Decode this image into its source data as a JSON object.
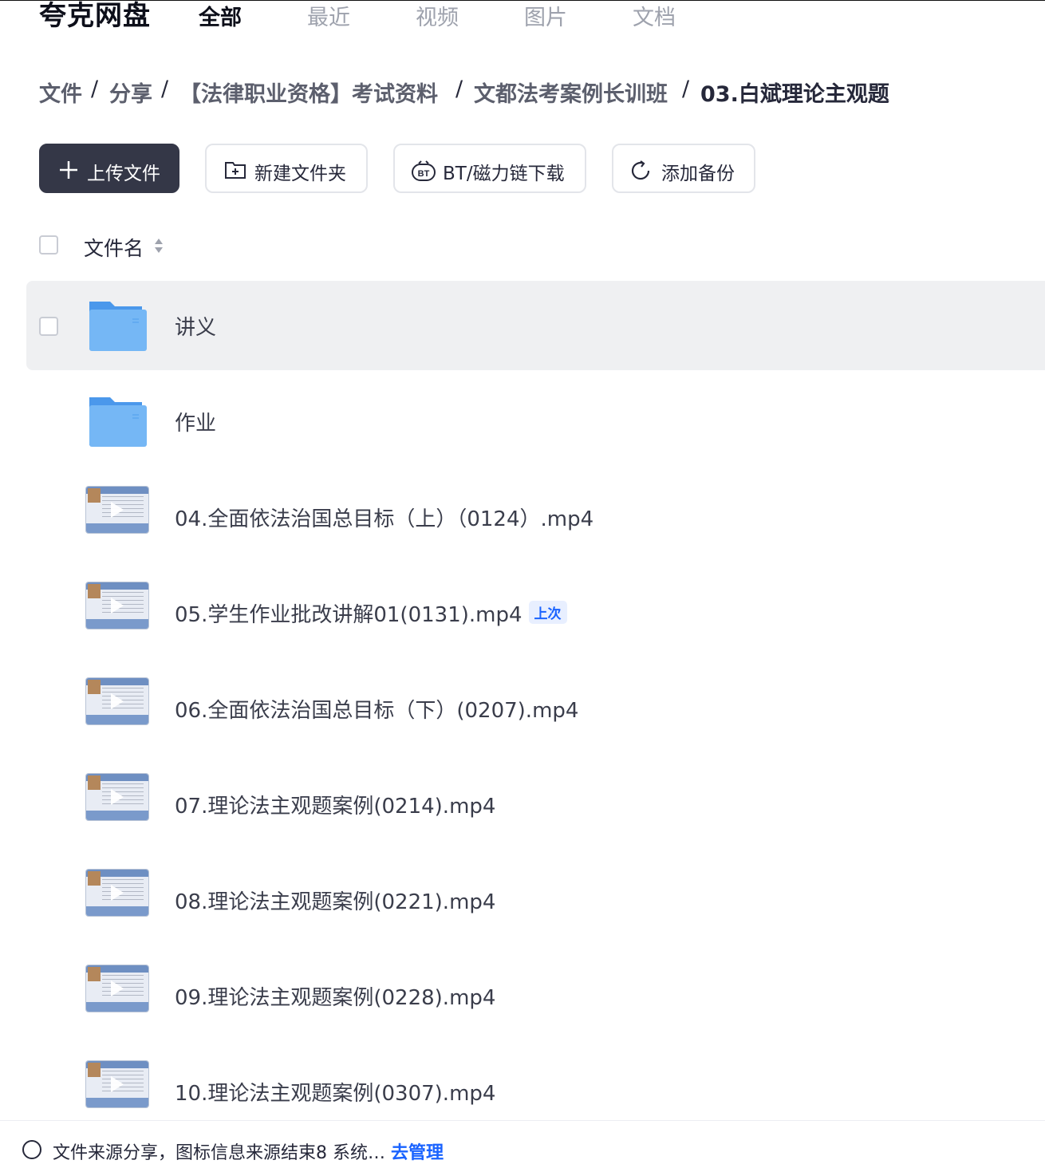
{
  "app": {
    "brand": "夸克网盘"
  },
  "topnav": {
    "tabs": [
      "全部",
      "最近",
      "视频",
      "图片",
      "文档"
    ],
    "active": "全部"
  },
  "breadcrumb": {
    "items": [
      "文件",
      "分享",
      "【法律职业资格】考试资料",
      "文都法考案例长训班",
      "03.白斌理论主观题"
    ],
    "separator": "/"
  },
  "toolbar": {
    "upload_label": "上传文件",
    "new_folder_label": "新建文件夹",
    "bt_label": "BT/磁力链下载",
    "backup_label": "添加备份"
  },
  "list": {
    "header_name": "文件名",
    "rows": [
      {
        "name": "讲义",
        "type": "folder"
      },
      {
        "name": "作业",
        "type": "folder"
      },
      {
        "name": "04.全面依法治国总目标（上）（0124）.mp4",
        "type": "video"
      },
      {
        "name": "05.学生作业批改讲解01(0131).mp4",
        "type": "video",
        "badge": "上次"
      },
      {
        "name": "06.全面依法治国总目标（下）(0207).mp4",
        "type": "video"
      },
      {
        "name": "07.理论法主观题案例(0214).mp4",
        "type": "video"
      },
      {
        "name": "08.理论法主观题案例(0221).mp4",
        "type": "video"
      },
      {
        "name": "09.理论法主观题案例(0228).mp4",
        "type": "video"
      },
      {
        "name": "10.理论法主观题案例(0307).mp4",
        "type": "video"
      }
    ]
  },
  "footer": {
    "text": "文件来源分享，图标信息来源结束8 系统…",
    "link": "去管理"
  },
  "colors": {
    "primary_button": "#343747",
    "accent": "#1a63ff",
    "folder": "#5aa7f0",
    "hover_row": "#eff0f2"
  }
}
